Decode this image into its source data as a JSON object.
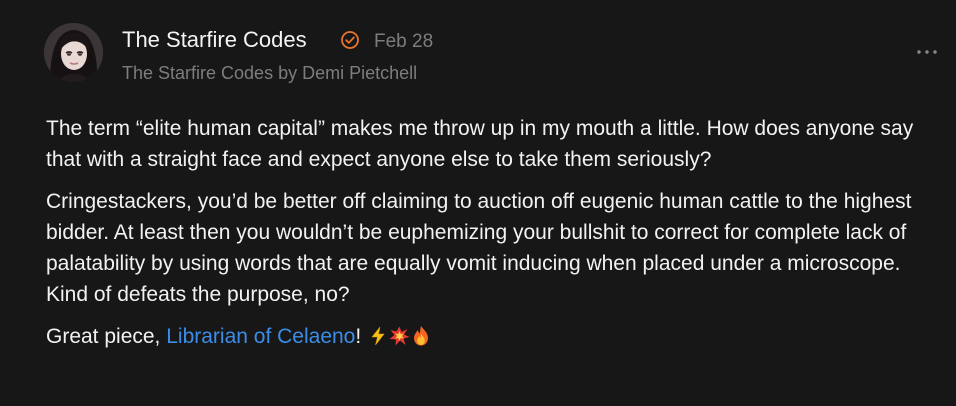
{
  "comment": {
    "author": {
      "name": "The Starfire Codes",
      "avatar_icon": "profile-photo",
      "verified_icon": "verified-check-icon"
    },
    "date": "Feb 28",
    "publication": "The Starfire Codes by Demi Pietchell",
    "more_icon": "ellipsis-icon",
    "paragraphs": [
      "The term “elite human capital” makes me throw up in my mouth a little. How does anyone say that with a straight face and expect anyone else to take them seriously?",
      "Cringestackers, you’d be better off claiming to auction off eugenic human cattle to the highest bidder. At least then you wouldn’t be euphemizing your bullshit to correct for complete lack of palatability by using words that are equally vomit inducing when placed under a microscope. Kind of defeats the purpose, no?"
    ],
    "closing": {
      "prefix": "Great piece, ",
      "mention": "Librarian of Celaeno",
      "suffix": "!",
      "emojis": [
        "lightning-icon",
        "collision-icon",
        "fire-icon"
      ]
    }
  },
  "colors": {
    "background": "#171717",
    "text": "#f2f2f2",
    "muted": "#7d7d7d",
    "link": "#3b8de8",
    "verified": "#e8752e"
  }
}
